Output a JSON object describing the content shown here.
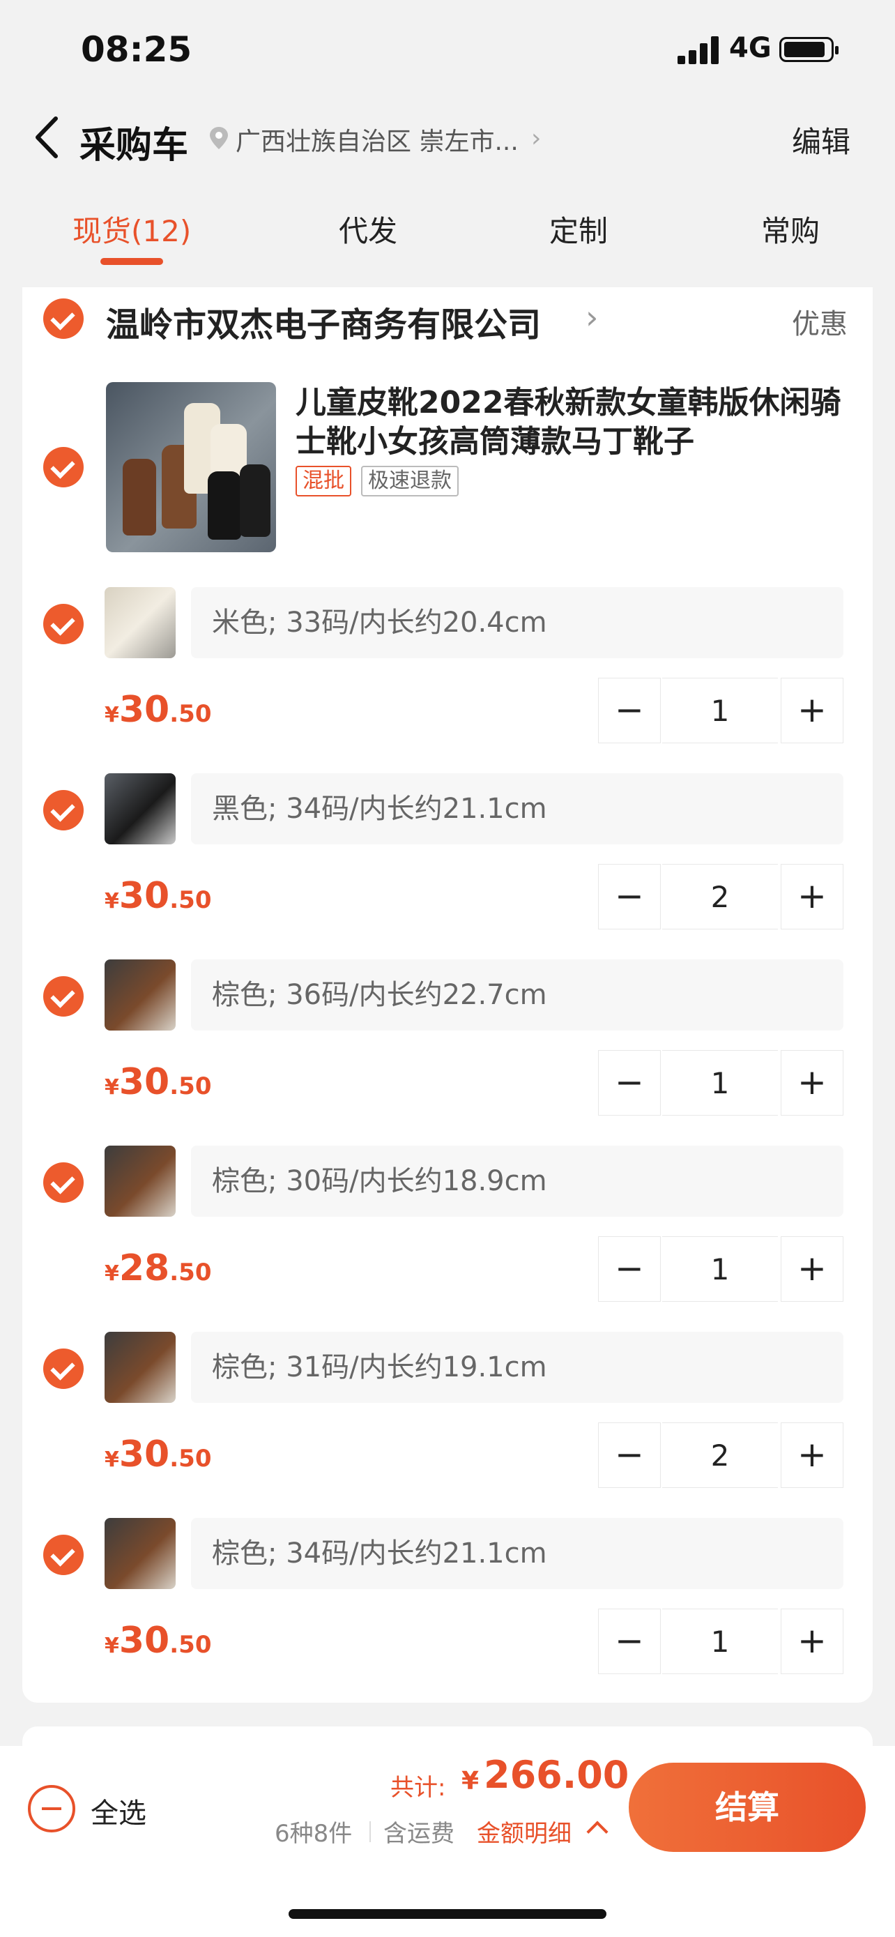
{
  "status_bar": {
    "time": "08:25",
    "network": "4G"
  },
  "nav": {
    "title": "采购车",
    "address": "广西壮族自治区 崇左市...",
    "edit_label": "编辑"
  },
  "tabs": [
    {
      "label": "现货(12)",
      "active": true
    },
    {
      "label": "代发",
      "active": false
    },
    {
      "label": "定制",
      "active": false
    },
    {
      "label": "常购",
      "active": false
    }
  ],
  "shop": {
    "name": "温岭市双杰电子商务有限公司",
    "discount_label": "优惠"
  },
  "product": {
    "title": "儿童皮靴2022春秋新款女童韩版休闲骑士靴小女孩高筒薄款马丁靴子",
    "tags": [
      "混批",
      "极速退款"
    ]
  },
  "skus": [
    {
      "spec": "米色; 33码/内长约20.4cm",
      "yen": "¥",
      "price_int": "30",
      "price_dec": ".50",
      "qty": "1"
    },
    {
      "spec": "黑色; 34码/内长约21.1cm",
      "yen": "¥",
      "price_int": "30",
      "price_dec": ".50",
      "qty": "2"
    },
    {
      "spec": "棕色; 36码/内长约22.7cm",
      "yen": "¥",
      "price_int": "30",
      "price_dec": ".50",
      "qty": "1"
    },
    {
      "spec": "棕色; 30码/内长约18.9cm",
      "yen": "¥",
      "price_int": "28",
      "price_dec": ".50",
      "qty": "1"
    },
    {
      "spec": "棕色; 31码/内长约19.1cm",
      "yen": "¥",
      "price_int": "30",
      "price_dec": ".50",
      "qty": "2"
    },
    {
      "spec": "棕色; 34码/内长约21.1cm",
      "yen": "¥",
      "price_int": "30",
      "price_dec": ".50",
      "qty": "1"
    }
  ],
  "stepper": {
    "minus": "−",
    "plus": "+"
  },
  "footer": {
    "select_all": "全选",
    "total_label": "共计:",
    "total_yen": "¥",
    "total_amount": "266.00",
    "count": "6种8件",
    "shipping": "含运费",
    "detail": "金额明细",
    "checkout": "结算"
  },
  "colors": {
    "accent": "#e8512a",
    "background": "#f2f2f2"
  },
  "icons": [
    "back-icon",
    "location-icon",
    "chevron-right-icon",
    "check-icon",
    "minus-icon",
    "plus-icon",
    "chevron-up-icon",
    "battery-icon",
    "signal-icon"
  ]
}
